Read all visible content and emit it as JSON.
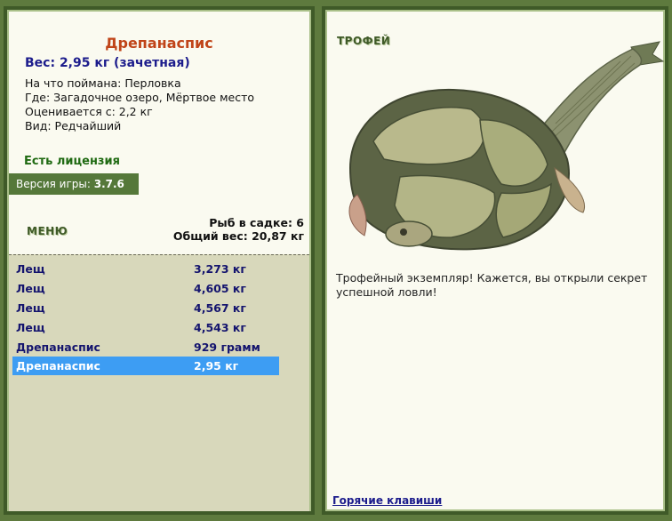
{
  "left": {
    "fish_name": "Дрепанаспис",
    "weight_line": "Вес: 2,95 кг (зачетная)",
    "caught_on": "На что поймана: Перловка",
    "location": "Где: Загадочное озеро, Мёртвое место",
    "valued_from": "Оценивается с: 2,2 кг",
    "rarity": "Вид: Редчайший",
    "license": "Есть лицензия",
    "version_label": "Версия игры:",
    "version_value": "3.7.6",
    "menu": "МЕНЮ",
    "cage_count": "Рыб в садке: 6",
    "cage_total": "Общий вес: 20,87 кг"
  },
  "fish_list": [
    {
      "name": "Лещ",
      "weight": "3,273 кг"
    },
    {
      "name": "Лещ",
      "weight": "4,605 кг"
    },
    {
      "name": "Лещ",
      "weight": "4,567 кг"
    },
    {
      "name": "Лещ",
      "weight": "4,543 кг"
    },
    {
      "name": "Дрепанаспис",
      "weight": "929 грамм"
    },
    {
      "name": "Дрепанаспис",
      "weight": "2,95 кг"
    }
  ],
  "right": {
    "trophy_label": "ТРОФЕЙ",
    "trophy_message": "Трофейный экземпляр! Кажется, вы открыли секрет успешной ловли!",
    "hotkeys": "Горячие клавиши"
  }
}
